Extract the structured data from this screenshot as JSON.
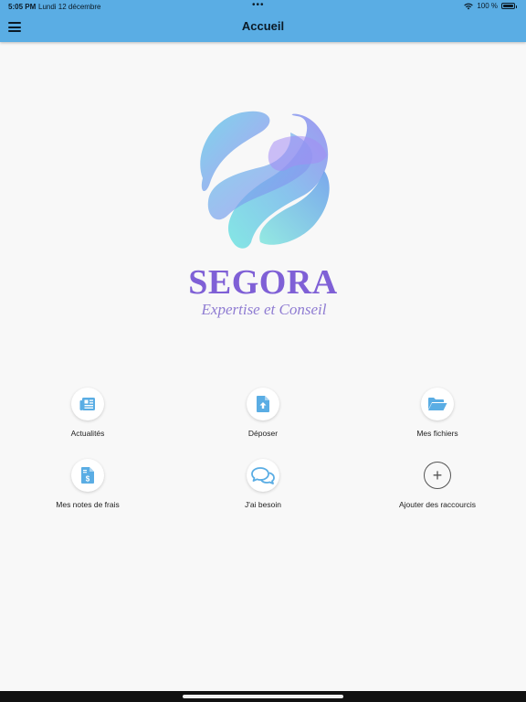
{
  "status_bar": {
    "time": "5:05 PM",
    "date": "Lundi 12 décembre",
    "dots": "•••",
    "battery_text": "100 %"
  },
  "header": {
    "title": "Accueil",
    "background": "#5aade4",
    "menu_icon": "hamburger-menu-icon"
  },
  "brand": {
    "name": "SEGORA",
    "tagline": "Expertise et Conseil",
    "color": "#7f60d6"
  },
  "shortcuts": [
    {
      "label": "Actualités",
      "icon": "newspaper-icon"
    },
    {
      "label": "Déposer",
      "icon": "file-upload-icon"
    },
    {
      "label": "Mes fichiers",
      "icon": "folder-open-icon"
    },
    {
      "label": "Mes notes de frais",
      "icon": "expense-file-icon"
    },
    {
      "label": "J'ai besoin",
      "icon": "chat-bubbles-icon"
    },
    {
      "label": "Ajouter des raccourcis",
      "icon": "plus-icon"
    }
  ],
  "icon_color": "#5aade4"
}
